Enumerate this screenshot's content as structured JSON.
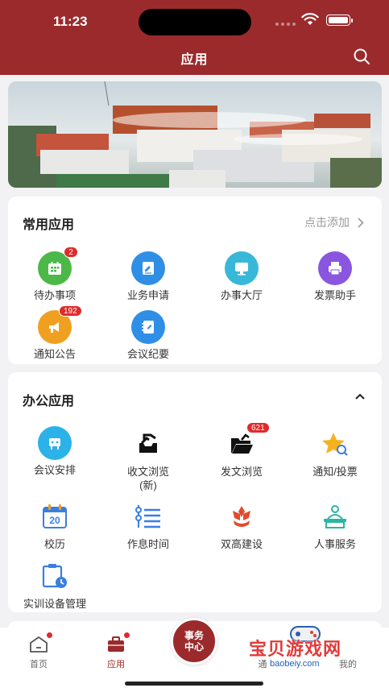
{
  "status_bar": {
    "time": "11:23"
  },
  "header": {
    "title": "应用",
    "search_icon": "search-icon",
    "bg_color": "#9b2a2c"
  },
  "banner": {
    "description_icon": "campus-photo"
  },
  "common_apps": {
    "title": "常用应用",
    "add_label": "点击添加",
    "items": [
      {
        "label": "待办事项",
        "icon": "calendar-icon",
        "color": "#4cb848",
        "badge": "2"
      },
      {
        "label": "业务申请",
        "icon": "edit-document-icon",
        "color": "#2f8fe6"
      },
      {
        "label": "办事大厅",
        "icon": "monitor-icon",
        "color": "#38b8d8"
      },
      {
        "label": "发票助手",
        "icon": "printer-icon",
        "color": "#8a56e0"
      },
      {
        "label": "通知公告",
        "icon": "megaphone-icon",
        "color": "#f0a020",
        "badge": "192"
      },
      {
        "label": "会议纪要",
        "icon": "notebook-icon",
        "color": "#2f8fe6"
      }
    ]
  },
  "office_apps": {
    "title": "办公应用",
    "collapse_icon": "chevron-up-icon",
    "items": [
      {
        "label": "会议安排",
        "icon": "meeting-icon",
        "color": "#2bb2e8"
      },
      {
        "label": "收文浏览",
        "label2": "(新)",
        "icon": "inbox-tray-icon",
        "color": "#111111"
      },
      {
        "label": "发文浏览",
        "icon": "folder-open-icon",
        "color": "#111111",
        "badge": "621"
      },
      {
        "label": "通知/投票",
        "icon": "star-search-icon",
        "color": "#f5b21f"
      },
      {
        "label": "校历",
        "icon": "calendar-20-icon",
        "color": "#3a7fe0"
      },
      {
        "label": "作息时间",
        "icon": "list-clock-icon",
        "color": "#3a7fe0"
      },
      {
        "label": "双高建设",
        "icon": "flower-icon",
        "color": "#e24b30"
      },
      {
        "label": "人事服务",
        "icon": "people-service-icon",
        "color": "#2bb5a5"
      },
      {
        "label": "实训设备管理",
        "icon": "clipboard-clock-icon",
        "color": "#3a7fe0"
      }
    ]
  },
  "tabbar": {
    "home": "首页",
    "apps": "应用",
    "center_line1": "事务",
    "center_line2": "中心",
    "contacts_partial": "通",
    "mine_partial": "我的"
  },
  "watermark": {
    "text": "宝贝游戏网",
    "url": "baobeiy.com"
  }
}
